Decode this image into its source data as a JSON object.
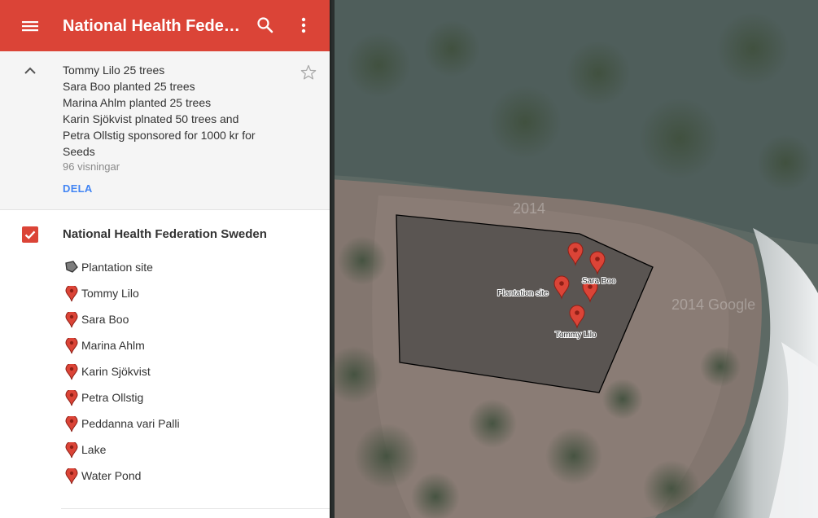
{
  "app": {
    "title": "National Health Federa...",
    "icons": {
      "menu": "menu-icon",
      "search": "search-icon",
      "more": "more-vert-icon"
    },
    "brand_color": "#db4437"
  },
  "description": {
    "lines": [
      "Tommy Lilo 25 trees",
      "Sara Boo planted 25 trees",
      "Marina Ahlm planted 25 trees",
      "Karin Sjökvist plnated 50 trees and",
      "Petra Ollstig sponsored for 1000 kr for",
      "Seeds"
    ],
    "views": "96 visningar",
    "share_label": "DELA"
  },
  "layer": {
    "title": "National Health Federation Sweden",
    "checked": true,
    "features": [
      {
        "label": "Plantation site",
        "icon": "polygon-icon"
      },
      {
        "label": "Tommy Lilo",
        "icon": "map-pin-icon"
      },
      {
        "label": "Sara Boo",
        "icon": "map-pin-icon"
      },
      {
        "label": "Marina Ahlm",
        "icon": "map-pin-icon"
      },
      {
        "label": "Karin Sjökvist",
        "icon": "map-pin-icon"
      },
      {
        "label": "Petra Ollstig",
        "icon": "map-pin-icon"
      },
      {
        "label": "Peddanna vari Palli",
        "icon": "map-pin-icon"
      },
      {
        "label": "Lake",
        "icon": "map-pin-icon"
      },
      {
        "label": "Water Pond",
        "icon": "map-pin-icon"
      }
    ]
  },
  "map": {
    "labels": {
      "plantation": "Plantation site",
      "sara": "Sara Boo",
      "tommy": "Tommy Lilo"
    },
    "watermark_year": "2014",
    "watermark": "2014 Google",
    "pin_color": "#db4437"
  }
}
